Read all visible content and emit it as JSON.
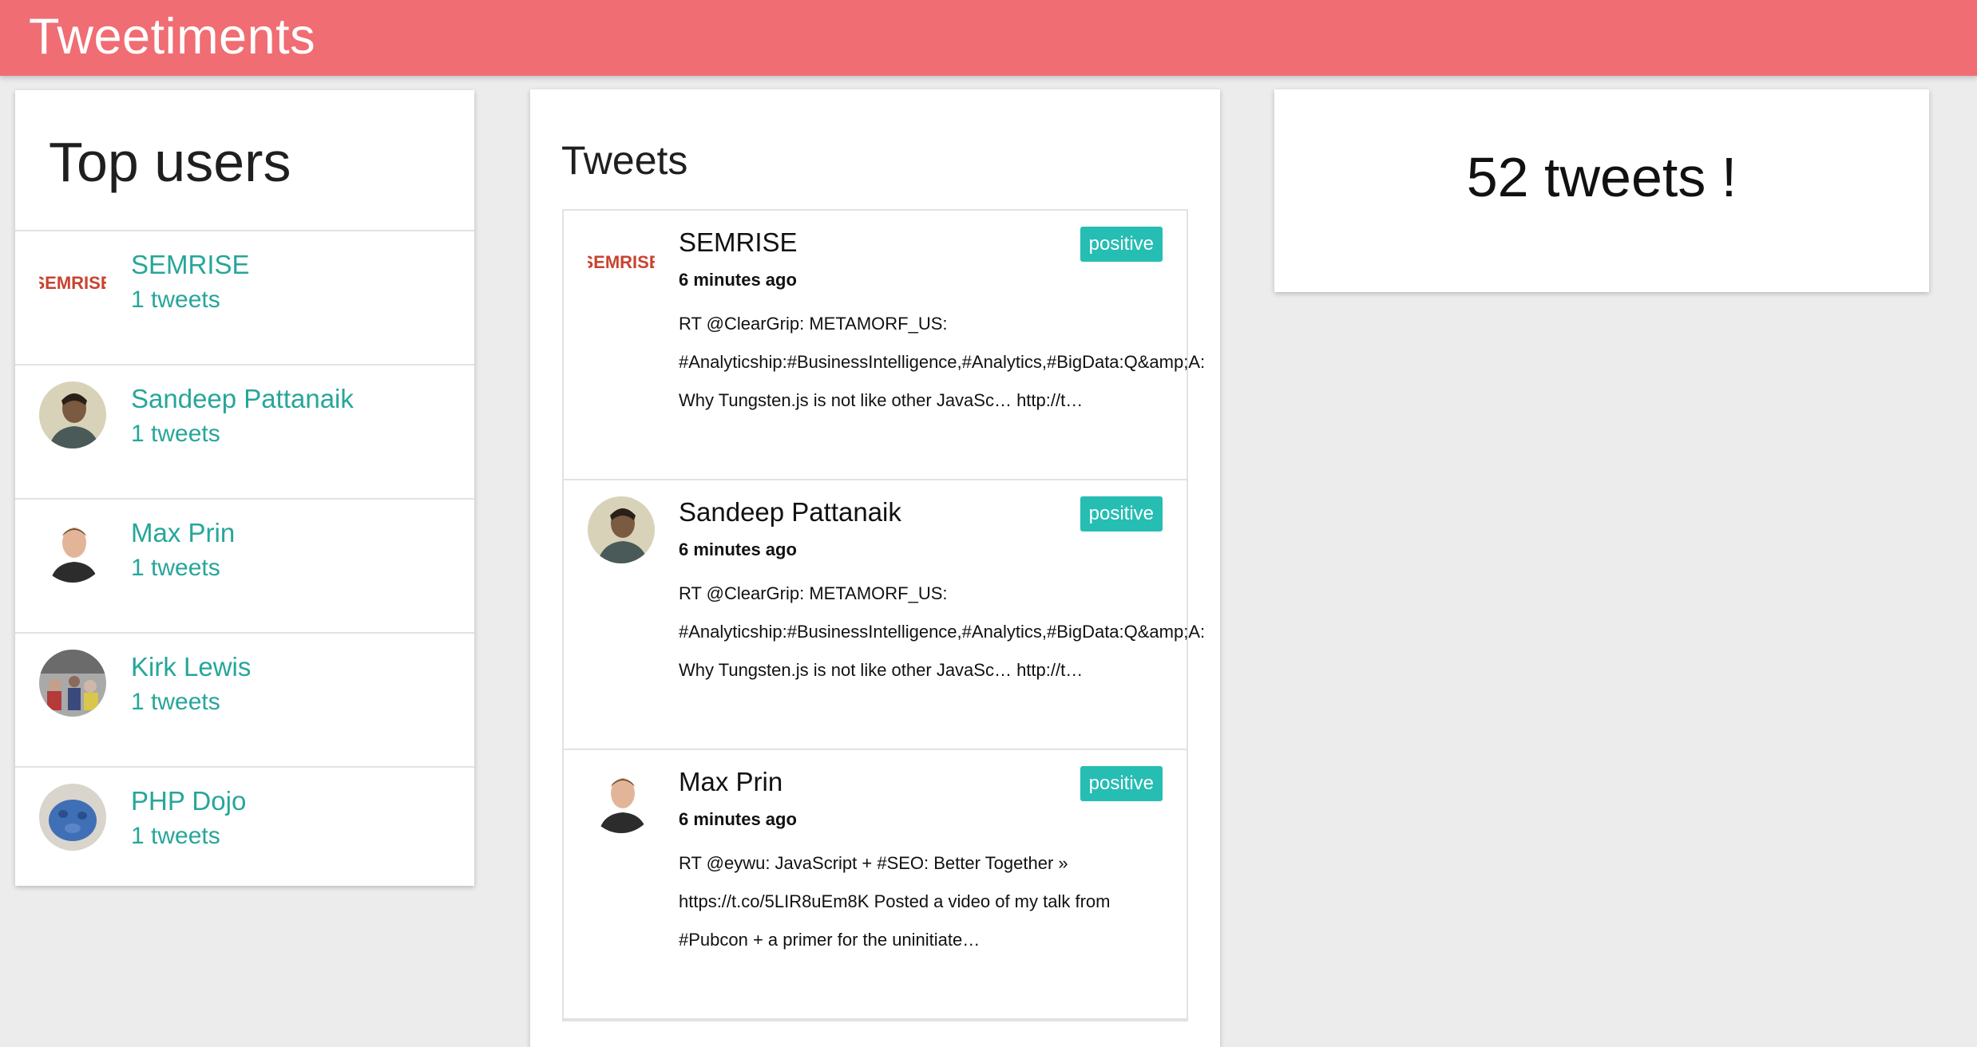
{
  "app": {
    "title": "Tweetiments",
    "accent_color": "#f06d73",
    "link_color": "#26a69a",
    "badge_color": "#26bdb3"
  },
  "top_users": {
    "title": "Top users",
    "users": [
      {
        "name": "SEMRISE",
        "count": "1 tweets",
        "avatar": "semrise-logo-avatar"
      },
      {
        "name": "Sandeep Pattanaik",
        "count": "1 tweets",
        "avatar": "person-avatar"
      },
      {
        "name": "Max Prin",
        "count": "1 tweets",
        "avatar": "person-avatar"
      },
      {
        "name": "Kirk Lewis",
        "count": "1 tweets",
        "avatar": "crowd-photo-avatar"
      },
      {
        "name": "PHP Dojo",
        "count": "1 tweets",
        "avatar": "blue-mascot-avatar"
      }
    ]
  },
  "tweets": {
    "title": "Tweets",
    "items": [
      {
        "author": "SEMRISE",
        "time": "6 minutes ago",
        "text": "RT @ClearGrip: METAMORF_US:\n#Analyticship:#BusinessIntelligence,#Analytics,#BigData:Q&amp;A:\nWhy Tungsten.js is not like other JavaSc… http://t…",
        "sentiment": "positive",
        "logo_text": "SEMRISE"
      },
      {
        "author": "Sandeep Pattanaik",
        "time": "6 minutes ago",
        "text": "RT @ClearGrip: METAMORF_US:\n#Analyticship:#BusinessIntelligence,#Analytics,#BigData:Q&amp;A:\nWhy Tungsten.js is not like other JavaSc… http://t…",
        "sentiment": "positive"
      },
      {
        "author": "Max Prin",
        "time": "6 minutes ago",
        "text": "RT @eywu: JavaScript + #SEO: Better Together »\nhttps://t.co/5LIR8uEm8K Posted a video of my talk from\n#Pubcon + a primer for the uninitiate…",
        "sentiment": "positive"
      }
    ]
  },
  "summary": {
    "count_text": "52 tweets !"
  }
}
